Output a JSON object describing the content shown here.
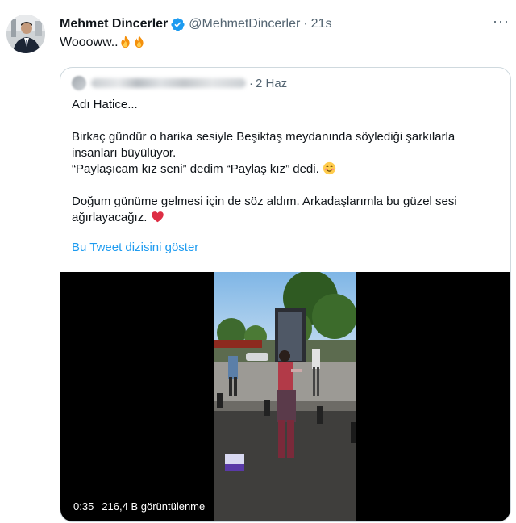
{
  "author": {
    "display_name": "Mehmet Dincerler",
    "handle": "@MehmetDincerler",
    "time": "21s",
    "more_label": "···",
    "verified": true
  },
  "tweet": {
    "text": "Woooww.."
  },
  "quoted": {
    "date": "2 Haz",
    "lines": [
      "Adı Hatice...",
      "Birkaç gündür o harika sesiyle Beşiktaş meydanında söylediği şarkılarla",
      "insanları büyülüyor.",
      "“Paylaşıcam kız seni” dedim “Paylaş kız” dedi.",
      "Doğum günüme gelmesi için de söz aldım. Arkadaşlarımla bu güzel sesi",
      "ağırlayacağız."
    ],
    "show_thread": "Bu Tweet dizisini göster"
  },
  "video": {
    "duration": "0:35",
    "views": "216,4 B görüntülenme"
  },
  "icons": {
    "verified": "verified-badge-icon",
    "fire": "fire-emoji-icon",
    "smile": "smiling-face-emoji-icon",
    "heart": "red-heart-emoji-icon"
  },
  "colors": {
    "link": "#1d9bf0",
    "secondary_text": "#536471",
    "border": "#cfd9de",
    "verified": "#1d9bf0"
  }
}
